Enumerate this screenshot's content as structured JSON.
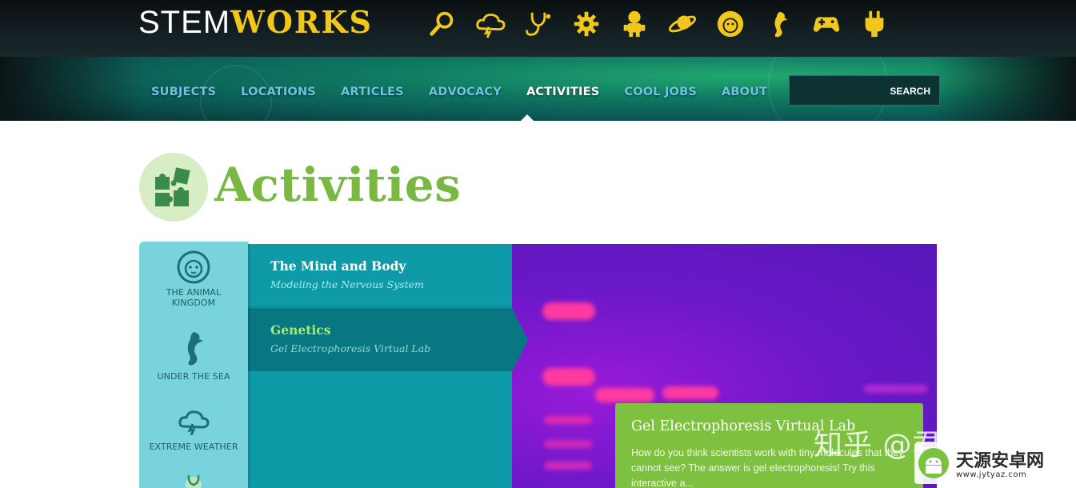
{
  "logo": {
    "part1": "STEM",
    "part2": "WORKS"
  },
  "header_icons": [
    "search-icon",
    "storm-cloud-icon",
    "stethoscope-icon",
    "gear-icon",
    "robot-icon",
    "planet-icon",
    "lion-icon",
    "seahorse-icon",
    "gamepad-icon",
    "plug-icon"
  ],
  "nav": {
    "items": [
      "SUBJECTS",
      "LOCATIONS",
      "ARTICLES",
      "ADVOCACY",
      "ACTIVITIES",
      "COOL JOBS",
      "ABOUT"
    ],
    "active": "ACTIVITIES"
  },
  "search": {
    "button_label": "SEARCH",
    "value": ""
  },
  "page": {
    "title": "Activities",
    "icon": "puzzle-icon"
  },
  "categories": [
    {
      "label": "THE ANIMAL KINGDOM",
      "icon": "lion-icon"
    },
    {
      "label": "UNDER THE SEA",
      "icon": "seahorse-icon"
    },
    {
      "label": "EXTREME WEATHER",
      "icon": "storm-cloud-icon"
    }
  ],
  "activities": [
    {
      "title": "The Mind and Body",
      "subtitle": "Modeling the Nervous System"
    },
    {
      "title": "Genetics",
      "subtitle": "Gel Electrophoresis Virtual Lab"
    }
  ],
  "feature_card": {
    "title": "Gel Electrophoresis Virtual Lab",
    "description": "How do you think scientists work with tiny molecules that they cannot see? The answer is gel electrophoresis! Try this interactive a..."
  },
  "watermarks": {
    "zhihu": "知乎 @君陌汝下",
    "site_name": "天源安卓网",
    "site_url": "www.jytyaz.com"
  },
  "colors": {
    "accent_yellow": "#f2c71c",
    "title_green": "#7ab844",
    "teal": "#0e9aa6",
    "nav_blue": "#6cc4e0"
  }
}
